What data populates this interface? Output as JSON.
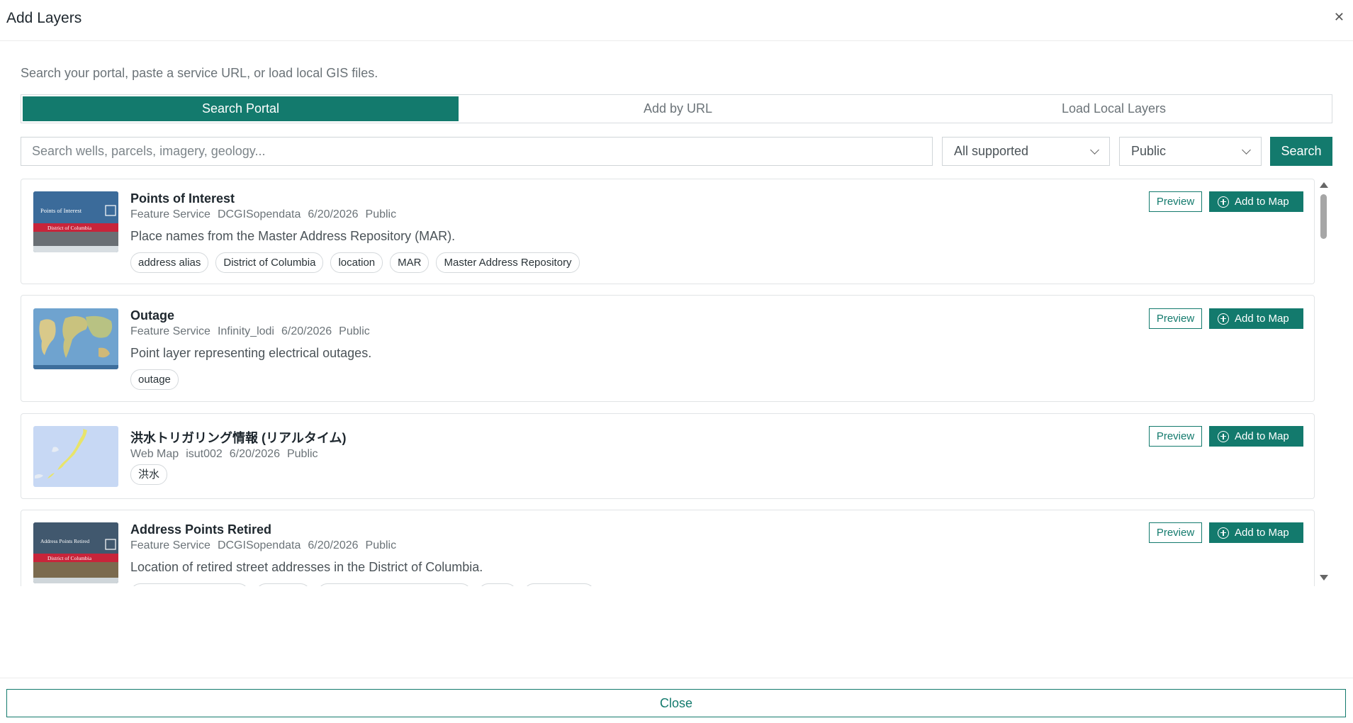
{
  "dialog": {
    "title": "Add Layers",
    "subtitle": "Search your portal, paste a service URL, or load local GIS files.",
    "close_label": "Close"
  },
  "tabs": [
    {
      "label": "Search Portal",
      "active": true
    },
    {
      "label": "Add by URL",
      "active": false
    },
    {
      "label": "Load Local Layers",
      "active": false
    }
  ],
  "search": {
    "placeholder": "Search wells, parcels, imagery, geology...",
    "value": "",
    "type_filter": "All supported",
    "access_filter": "Public",
    "button_label": "Search"
  },
  "buttons": {
    "preview_label": "Preview",
    "add_label": "Add to Map"
  },
  "results": [
    {
      "title": "Points of Interest",
      "type": "Feature Service",
      "owner": "DCGISopendata",
      "date": "6/20/2026",
      "access": "Public",
      "description": "Place names from the Master Address Repository (MAR).",
      "tags": [
        "address alias",
        "District of Columbia",
        "location",
        "MAR",
        "Master Address Repository"
      ],
      "thumb_text": "Points of Interest",
      "thumb_sub": "District of Columbia"
    },
    {
      "title": "Outage",
      "type": "Feature Service",
      "owner": "Infinity_lodi",
      "date": "6/20/2026",
      "access": "Public",
      "description": "Point layer representing electrical outages.",
      "tags": [
        "outage"
      ]
    },
    {
      "title": "洪水トリガリング情報 (リアルタイム)",
      "type": "Web Map",
      "owner": "isut002",
      "date": "6/20/2026",
      "access": "Public",
      "description": "",
      "tags": [
        "洪水"
      ]
    },
    {
      "title": "Address Points Retired",
      "type": "Feature Service",
      "owner": "DCGISopendata",
      "date": "6/20/2026",
      "access": "Public",
      "description": "Location of retired street addresses in the District of Columbia.",
      "tags": [],
      "thumb_text": "Address Points Retired",
      "thumb_sub": "District of Columbia"
    }
  ],
  "colors": {
    "accent": "#137a6d"
  }
}
